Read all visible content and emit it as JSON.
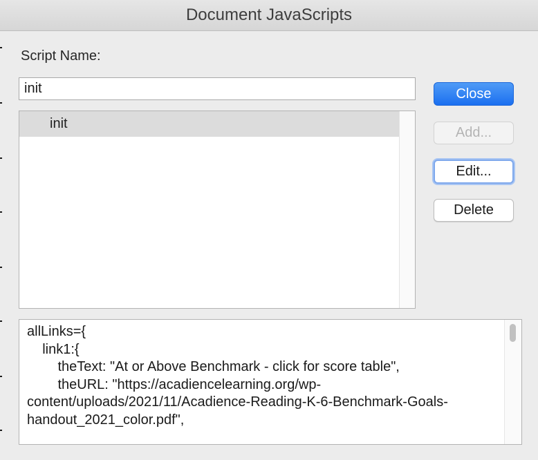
{
  "window": {
    "title": "Document JavaScripts"
  },
  "form": {
    "script_name_label": "Script Name:",
    "script_name_value": "init"
  },
  "scripts_list": {
    "items": [
      {
        "label": "init",
        "selected": true
      }
    ]
  },
  "buttons": {
    "close": "Close",
    "add": "Add...",
    "edit": "Edit...",
    "delete": "Delete"
  },
  "script_source": {
    "text": "allLinks={\n\tlink1:{\n\t\ttheText: \"At or Above Benchmark - click for score table\",\n\t\ttheURL: \"https://acadiencelearning.org/wp-content/uploads/2021/11/Acadience-Reading-K-6-Benchmark-Goals-handout_2021_color.pdf\","
  },
  "colors": {
    "primary_button": "#1b6ff0",
    "focus_ring": "#7ea8ec",
    "selection": "#dcdcdc",
    "dialog_background": "#ececec"
  }
}
